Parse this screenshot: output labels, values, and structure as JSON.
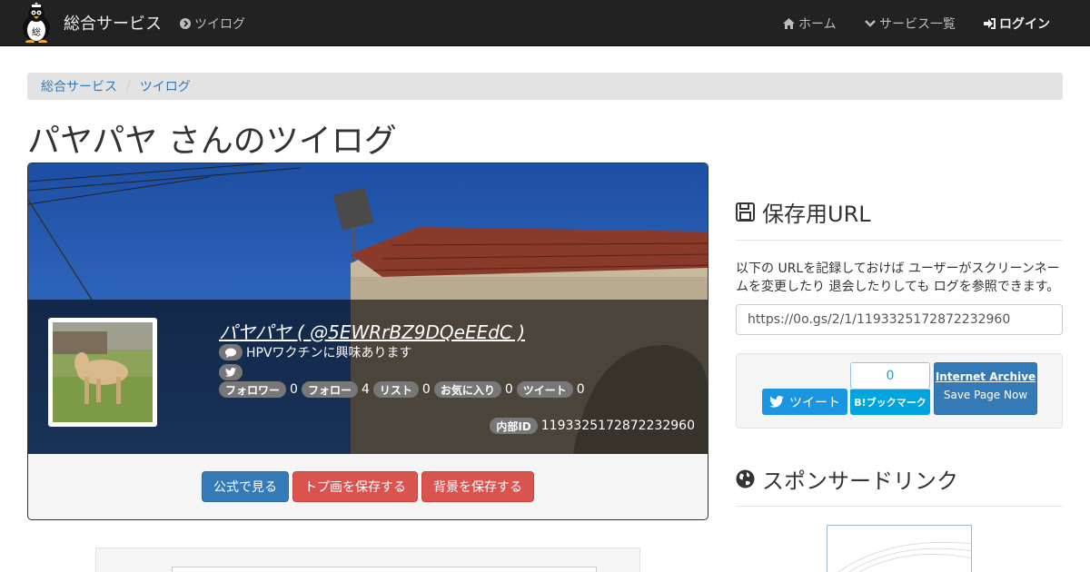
{
  "navbar": {
    "brand": "総合サービス",
    "tsuilog": "ツイログ",
    "home": "ホーム",
    "services": "サービス一覧",
    "login": "ログイン"
  },
  "breadcrumb": {
    "items": [
      "総合サービス",
      "ツイログ"
    ]
  },
  "page_title": "パヤパヤ さんのツイログ",
  "profile": {
    "display_name": "パヤパヤ ( @5EWRrBZ9DQeEEdC )",
    "bio": "HPVワクチンに興味あります",
    "stats": [
      {
        "label": "フォロワー",
        "value": "0"
      },
      {
        "label": "フォロー",
        "value": "4"
      },
      {
        "label": "リスト",
        "value": "0"
      },
      {
        "label": "お気に入り",
        "value": "0"
      },
      {
        "label": "ツイート",
        "value": "0"
      }
    ],
    "internal_id_label": "内部ID",
    "internal_id": "1193325172872232960"
  },
  "buttons": {
    "official": "公式で見る",
    "save_top": "トプ画を保存する",
    "save_bg": "背景を保存する"
  },
  "sidebar": {
    "save_url_title": "保存用URL",
    "description": "以下の URLを記録しておけば ユーザーがスクリーンネームを変更したり 退会したりしても ログを参照できます。",
    "url": "https://0o.gs/2/1/1193325172872232960",
    "tweet": "ツイート",
    "hatena_count": "0",
    "hatena_label": "B!ブックマーク",
    "ia_title": "Internet Archive",
    "ia_sub": "Save Page Now",
    "sponsored_title": "スポンサードリンク"
  },
  "colors": {
    "navbar": "#222222",
    "primary": "#337ab7",
    "danger": "#d9534f",
    "twitter": "#1b95e0",
    "hatena": "#00a4de"
  }
}
